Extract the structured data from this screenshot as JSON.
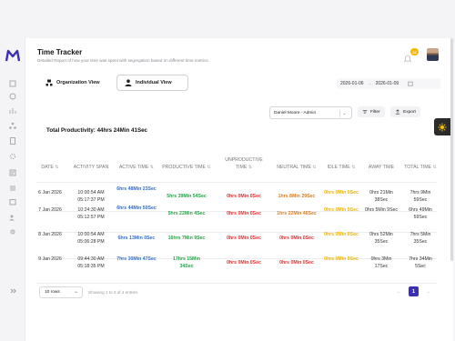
{
  "app": {
    "title": "Time Tracker",
    "subtitle": "Detailed Report of how your time was spent with segregation based on different time metrics."
  },
  "header": {
    "notification_count": "22"
  },
  "tabs": [
    {
      "label": "Organization View"
    },
    {
      "label": "Individual View"
    }
  ],
  "dates": {
    "from": "2026-01-06",
    "separator": "→",
    "to": "2026-01-09"
  },
  "employee_select": {
    "value": "Daniel Moore - Admin"
  },
  "buttons": {
    "filter": "Filter",
    "export": "Export"
  },
  "total_productivity": "Total Productivity: 44hrs 24Min 41Sec",
  "table": {
    "headers": [
      "DATE",
      "ACTIVITY SPAN",
      "ACTIVE TIME",
      "PRODUCTIVE TIME",
      "UNPRODUCTIVE TIME",
      "NEUTRAL TIME",
      "IDLE TIME",
      "AWAY TIME",
      "TOTAL TIME"
    ],
    "rows": [
      {
        "date": "6 Jan 2026",
        "span": "10:00:54 AM 05:17:37 PM",
        "active": "6hrs 48Min 23Sec",
        "productive": "5hrs 39Min 54Sec",
        "unproductive": "0hrs 0Min 0Sec",
        "neutral": "1hrs 8Min 29Sec",
        "idle": "0hrs 0Min 0Sec",
        "away": "0hrs 21Min 38Sec",
        "total": "7hrs 9Min 59Sec"
      },
      {
        "date": "7 Jan 2026",
        "span": "10:24:30 AM 05:12:57 PM",
        "active": "6hrs 44Min 50Sec",
        "productive": "5hrs 22Min 4Sec",
        "unproductive": "0hrs 0Min 0Sec",
        "neutral": "1hrs 22Min 46Sec",
        "idle": "0hrs 0Min 0Sec",
        "away": "0hrs 5Min 9Sec",
        "total": "6hrs 49Min 59Sec"
      },
      {
        "date": "8 Jan 2026",
        "span": "10:00:54 AM 05:06:28 PM",
        "active": "6hrs 13Min 0Sec",
        "productive": "16hrs 7Min 9Sec",
        "unproductive": "0hrs 0Min 0Sec",
        "neutral": "0hrs 0Min 0Sec",
        "idle": "0hrs 0Min 0Sec",
        "away": "0hrs 52Min 35Sec",
        "total": "7hrs 5Min 35Sec"
      },
      {
        "date": "9 Jan 2026",
        "span": "09:44:30 AM 05:18:35 PM",
        "active": "7hrs 30Min 47Sec",
        "productive": "17hrs 15Min 34Sec",
        "unproductive": "0hrs 0Min 0Sec",
        "neutral": "0hrs 0Min 0Sec",
        "idle": "0hrs 0Min 0Sec",
        "away": "0hrs 3Min 17Sec",
        "total": "7hrs 34Min 5Sec"
      }
    ]
  },
  "footer": {
    "rows_per_page": "10 rows",
    "showing": "Showing 1 to 4 of 4 entries",
    "page": "1"
  },
  "colors": {
    "accent": "#3b2fb5",
    "active": "#2f6fd6",
    "productive": "#24a544",
    "unproductive": "#e03030",
    "neutral": "#e07a1a",
    "idle": "#f0b400"
  }
}
